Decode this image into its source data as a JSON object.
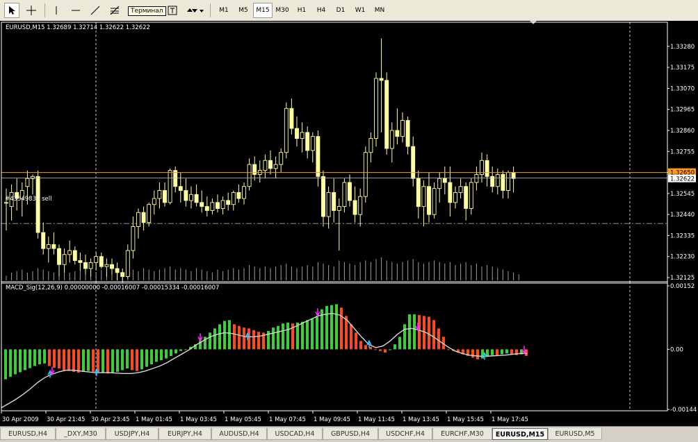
{
  "toolbar": {
    "tooltip": "Терминал",
    "timeframes": [
      "M1",
      "M5",
      "M15",
      "M30",
      "H1",
      "H4",
      "D1",
      "W1",
      "MN"
    ],
    "active_timeframe": "M15"
  },
  "price_chart": {
    "header": "EURUSD,M15  1.32689 1.32714 1.32622 1.32622",
    "order_label": "#43549836 sell",
    "current_price": "1.32622",
    "bid_price": "1.32650"
  },
  "macd_chart": {
    "header": "MACD_Sig(12,26,9) 0.00000000 -0.00016007 -0.00015334 -0.00016007"
  },
  "colors": {
    "background": "#000000",
    "up_candle": "#ffffa0",
    "down_candle": "#ffffa0",
    "volume": "#a0a0a0",
    "bid_line": "#ff9a20",
    "macd_up": "#3ccf3c",
    "macd_down": "#ff4a20",
    "signal": "#d8d8d8",
    "arrow_up": "#30c0ff",
    "arrow_down": "#ff30ff"
  },
  "chart_data": [
    {
      "type": "candlestick",
      "symbol": "EURUSD",
      "timeframe": "M15",
      "ylim": [
        1.32125,
        1.3338
      ],
      "yticks": [
        "1.33280",
        "1.33175",
        "1.33070",
        "1.32965",
        "1.32860",
        "1.32755",
        "1.32650",
        "1.32545",
        "1.32440",
        "1.32335",
        "1.32230",
        "1.32125"
      ],
      "xticks": [
        "30 Apr 2009",
        "30 Apr 21:45",
        "30 Apr 23:45",
        "1 May 01:45",
        "1 May 03:45",
        "1 May 05:45",
        "1 May 07:45",
        "1 May 09:45",
        "1 May 11:45",
        "1 May 13:45",
        "1 May 15:45",
        "1 May 17:45"
      ],
      "order_level": 1.32395,
      "ohlc": [
        [
          1.325,
          1.3257,
          1.3236,
          1.325
        ],
        [
          1.3248,
          1.3259,
          1.3241,
          1.3255
        ],
        [
          1.3255,
          1.3262,
          1.3246,
          1.3252
        ],
        [
          1.3252,
          1.326,
          1.3243,
          1.3256
        ],
        [
          1.3258,
          1.3266,
          1.3249,
          1.3262
        ],
        [
          1.3262,
          1.3264,
          1.3254,
          1.3263
        ],
        [
          1.3263,
          1.3266,
          1.3232,
          1.3235
        ],
        [
          1.3235,
          1.324,
          1.3224,
          1.3227
        ],
        [
          1.3227,
          1.3233,
          1.322,
          1.3229
        ],
        [
          1.3229,
          1.3235,
          1.3224,
          1.3227
        ],
        [
          1.3227,
          1.3229,
          1.3213,
          1.3219
        ],
        [
          1.3219,
          1.3227,
          1.3215,
          1.3224
        ],
        [
          1.3224,
          1.3231,
          1.322,
          1.3226
        ],
        [
          1.3226,
          1.3228,
          1.3219,
          1.3221
        ],
        [
          1.3221,
          1.3225,
          1.3216,
          1.322
        ],
        [
          1.322,
          1.3224,
          1.3214,
          1.3217
        ],
        [
          1.3217,
          1.3222,
          1.3213,
          1.322
        ],
        [
          1.322,
          1.3225,
          1.3216,
          1.3223
        ],
        [
          1.3223,
          1.3225,
          1.3217,
          1.3218
        ],
        [
          1.3218,
          1.3222,
          1.3213,
          1.3219
        ],
        [
          1.3219,
          1.3222,
          1.3214,
          1.3217
        ],
        [
          1.3217,
          1.322,
          1.3211,
          1.3215
        ],
        [
          1.3215,
          1.3217,
          1.321,
          1.3213
        ],
        [
          1.3213,
          1.3229,
          1.3212,
          1.3226
        ],
        [
          1.3226,
          1.3243,
          1.3222,
          1.3238
        ],
        [
          1.3238,
          1.3247,
          1.3232,
          1.3245
        ],
        [
          1.3245,
          1.3248,
          1.3236,
          1.324
        ],
        [
          1.324,
          1.325,
          1.3238,
          1.3249
        ],
        [
          1.3249,
          1.3256,
          1.3244,
          1.3252
        ],
        [
          1.3252,
          1.326,
          1.3247,
          1.3256
        ],
        [
          1.3256,
          1.326,
          1.3248,
          1.325
        ],
        [
          1.325,
          1.3267,
          1.3249,
          1.3266
        ],
        [
          1.3266,
          1.3268,
          1.3255,
          1.3258
        ],
        [
          1.3258,
          1.3265,
          1.325,
          1.3256
        ],
        [
          1.3256,
          1.3262,
          1.3248,
          1.3251
        ],
        [
          1.3251,
          1.3258,
          1.3247,
          1.3254
        ],
        [
          1.3254,
          1.3259,
          1.3248,
          1.325
        ],
        [
          1.325,
          1.3256,
          1.3245,
          1.3248
        ],
        [
          1.3248,
          1.3253,
          1.3243,
          1.3246
        ],
        [
          1.3246,
          1.3252,
          1.3244,
          1.325
        ],
        [
          1.325,
          1.3254,
          1.3245,
          1.3247
        ],
        [
          1.3247,
          1.3253,
          1.3244,
          1.3251
        ],
        [
          1.3251,
          1.3255,
          1.3246,
          1.3249
        ],
        [
          1.3249,
          1.3256,
          1.3246,
          1.3255
        ],
        [
          1.3255,
          1.3259,
          1.325,
          1.3252
        ],
        [
          1.3252,
          1.326,
          1.3249,
          1.3258
        ],
        [
          1.3258,
          1.3272,
          1.3256,
          1.3269
        ],
        [
          1.3269,
          1.3273,
          1.3261,
          1.3264
        ],
        [
          1.3264,
          1.3271,
          1.326,
          1.3266
        ],
        [
          1.3266,
          1.3274,
          1.3262,
          1.3271
        ],
        [
          1.3271,
          1.3276,
          1.3264,
          1.3267
        ],
        [
          1.3267,
          1.3273,
          1.3262,
          1.3269
        ],
        [
          1.3269,
          1.3277,
          1.3265,
          1.3275
        ],
        [
          1.3275,
          1.33,
          1.3272,
          1.3297
        ],
        [
          1.3297,
          1.3302,
          1.3284,
          1.3287
        ],
        [
          1.3287,
          1.3293,
          1.3278,
          1.3282
        ],
        [
          1.3282,
          1.329,
          1.3275,
          1.3285
        ],
        [
          1.3285,
          1.3288,
          1.3272,
          1.3276
        ],
        [
          1.3276,
          1.3285,
          1.327,
          1.3283
        ],
        [
          1.3283,
          1.3286,
          1.3258,
          1.3263
        ],
        [
          1.3263,
          1.3266,
          1.3238,
          1.3243
        ],
        [
          1.3243,
          1.3258,
          1.3237,
          1.3255
        ],
        [
          1.3255,
          1.3262,
          1.324,
          1.3246
        ],
        [
          1.3246,
          1.3252,
          1.3226,
          1.3248
        ],
        [
          1.3248,
          1.3262,
          1.3245,
          1.326
        ],
        [
          1.326,
          1.3264,
          1.3248,
          1.3251
        ],
        [
          1.3251,
          1.3258,
          1.324,
          1.3244
        ],
        [
          1.3244,
          1.3257,
          1.3238,
          1.3253
        ],
        [
          1.3253,
          1.3278,
          1.325,
          1.3275
        ],
        [
          1.3275,
          1.3285,
          1.327,
          1.3282
        ],
        [
          1.3282,
          1.3315,
          1.3278,
          1.3312
        ],
        [
          1.3312,
          1.3332,
          1.3285,
          1.3311
        ],
        [
          1.3311,
          1.3315,
          1.3274,
          1.3277
        ],
        [
          1.3277,
          1.329,
          1.327,
          1.3286
        ],
        [
          1.3286,
          1.3297,
          1.3279,
          1.3283
        ],
        [
          1.3283,
          1.3295,
          1.328,
          1.3291
        ],
        [
          1.3291,
          1.3293,
          1.3274,
          1.3278
        ],
        [
          1.3278,
          1.3283,
          1.3258,
          1.3262
        ],
        [
          1.3262,
          1.3266,
          1.3242,
          1.3248
        ],
        [
          1.3248,
          1.3261,
          1.3238,
          1.3258
        ],
        [
          1.3258,
          1.3265,
          1.324,
          1.3244
        ],
        [
          1.3244,
          1.326,
          1.3242,
          1.3257
        ],
        [
          1.3257,
          1.3265,
          1.325,
          1.3262
        ],
        [
          1.3262,
          1.3268,
          1.3254,
          1.326
        ],
        [
          1.326,
          1.3268,
          1.3243,
          1.325
        ],
        [
          1.325,
          1.3258,
          1.3247,
          1.3255
        ],
        [
          1.3255,
          1.3262,
          1.3252,
          1.3258
        ],
        [
          1.3258,
          1.326,
          1.3241,
          1.3247
        ],
        [
          1.3247,
          1.3262,
          1.3244,
          1.326
        ],
        [
          1.326,
          1.3268,
          1.3256,
          1.3264
        ],
        [
          1.3264,
          1.3275,
          1.326,
          1.3271
        ],
        [
          1.3271,
          1.3274,
          1.3258,
          1.3263
        ],
        [
          1.3263,
          1.3268,
          1.3255,
          1.3258
        ],
        [
          1.3258,
          1.3267,
          1.3254,
          1.3264
        ],
        [
          1.3264,
          1.3266,
          1.3252,
          1.3256
        ],
        [
          1.3256,
          1.3266,
          1.3252,
          1.3265
        ],
        [
          1.3265,
          1.3268,
          1.3255,
          1.3262
        ]
      ],
      "volumes": [
        3,
        5,
        6,
        7,
        5,
        6,
        8,
        7,
        6,
        5,
        7,
        6,
        5,
        6,
        7,
        5,
        6,
        5,
        7,
        6,
        5,
        6,
        5,
        8,
        7,
        6,
        8,
        7,
        6,
        7,
        8,
        9,
        7,
        8,
        7,
        6,
        8,
        7,
        6,
        5,
        7,
        6,
        7,
        8,
        7,
        8,
        10,
        9,
        8,
        9,
        8,
        9,
        10,
        11,
        9,
        8,
        9,
        10,
        9,
        12,
        11,
        10,
        9,
        13,
        12,
        11,
        10,
        12,
        13,
        12,
        14,
        15,
        13,
        12,
        11,
        12,
        13,
        14,
        12,
        11,
        12,
        13,
        12,
        11,
        12,
        10,
        11,
        12,
        10,
        11,
        9,
        10,
        9,
        8,
        7,
        6,
        5,
        4
      ]
    },
    {
      "type": "bar",
      "title": "MACD_Sig(12,26,9)",
      "ylim": [
        -0.00144,
        0.00152
      ],
      "yticks": [
        "0.00152",
        "0.00",
        "-0.00144"
      ],
      "histogram": [
        -0.00072,
        -0.00066,
        -0.0006,
        -0.00055,
        -0.0005,
        -0.00045,
        -0.0004,
        -0.00036,
        -0.00034,
        -0.0004,
        -0.00044,
        -0.00046,
        -0.0005,
        -0.00052,
        -0.00054,
        -0.00056,
        -0.00054,
        -0.00052,
        -0.00054,
        -0.00056,
        -0.00056,
        -0.00058,
        -0.00056,
        -0.00054,
        -0.0005,
        -0.00046,
        -0.0005,
        -0.00052,
        -0.00048,
        -0.00042,
        -0.00036,
        -0.0003,
        -0.00026,
        -0.00022,
        -0.00016,
        -0.0001,
        -4e-05,
        0.0,
        6e-05,
        0.00012,
        0.0002,
        0.0003,
        0.0004,
        0.0005,
        0.0006,
        0.00068,
        0.0007,
        0.0006,
        0.00056,
        0.00052,
        0.0005,
        0.00046,
        0.00042,
        0.0004,
        0.00044,
        0.00052,
        0.00056,
        0.00062,
        0.00064,
        0.00062,
        0.00064,
        0.00066,
        0.0007,
        0.00074,
        0.0008,
        0.00096,
        0.00104,
        0.00106,
        0.00108,
        0.001,
        0.0008,
        0.0006,
        0.0004,
        0.0002,
        0.0001,
        6e-05,
        0.0,
        -4e-05,
        -8e-05,
        -2e-05,
        0.00012,
        0.0003,
        0.0006,
        0.00084,
        0.00084,
        0.00082,
        0.0008,
        0.00078,
        0.0007,
        0.0005,
        0.0003,
        0.0,
        -4e-05,
        -8e-05,
        -0.00012,
        -0.00016,
        -0.0002,
        -0.00024,
        -0.00022,
        -0.00018,
        -0.00014,
        -0.00016,
        -0.00012,
        -0.0001,
        -0.00012,
        -0.00014,
        -0.00012,
        -0.00016
      ],
      "signal": [
        -0.0014,
        -0.0013,
        -0.0012,
        -0.00108,
        -0.00095,
        -0.0008,
        -0.00068,
        -0.0006,
        -0.00054,
        -0.0005,
        -0.0005,
        -0.00052,
        -0.00054,
        -0.00056,
        -0.00056,
        -0.00056,
        -0.00057,
        -0.00058,
        -0.00058,
        -0.00056,
        -0.00052,
        -0.00046,
        -0.0004,
        -0.00032,
        -0.00022,
        -0.00012,
        -2e-05,
        0.0001,
        0.0002,
        0.0003,
        0.00036,
        0.0004,
        0.00038,
        0.00034,
        0.0003,
        0.0003,
        0.00032,
        0.00036,
        0.0004,
        0.00044,
        0.00048,
        0.00056,
        0.00064,
        0.00072,
        0.0008,
        0.00084,
        0.00086,
        0.00082,
        0.0007,
        0.0005,
        0.0003,
        0.00012,
        4e-05,
        8e-05,
        0.0002,
        0.00036,
        0.00048,
        0.0005,
        0.00046,
        0.0004,
        0.0003,
        0.00018,
        6e-05,
        -4e-05,
        -0.0001,
        -0.00014,
        -0.00016,
        -0.00017,
        -0.00016,
        -0.00015,
        -0.00014,
        -0.00012,
        -0.0001,
        -0.0001
      ],
      "arrows_up": [
        14,
        28,
        71,
        106,
        139,
        155,
        170
      ],
      "arrows_down": [
        15,
        55,
        88,
        121,
        188
      ]
    }
  ],
  "tabs": [
    "EURUSD,H4",
    "_DXY,M30",
    "USDJPY,H4",
    "EURJPY,H4",
    "AUDUSD,H4",
    "USDCAD,H4",
    "GBPUSD,H4",
    "USDCHF,H4",
    "EURCHF,M30",
    "EURUSD,M15",
    "EURUSD,M5"
  ],
  "active_tab": "EURUSD,M15"
}
